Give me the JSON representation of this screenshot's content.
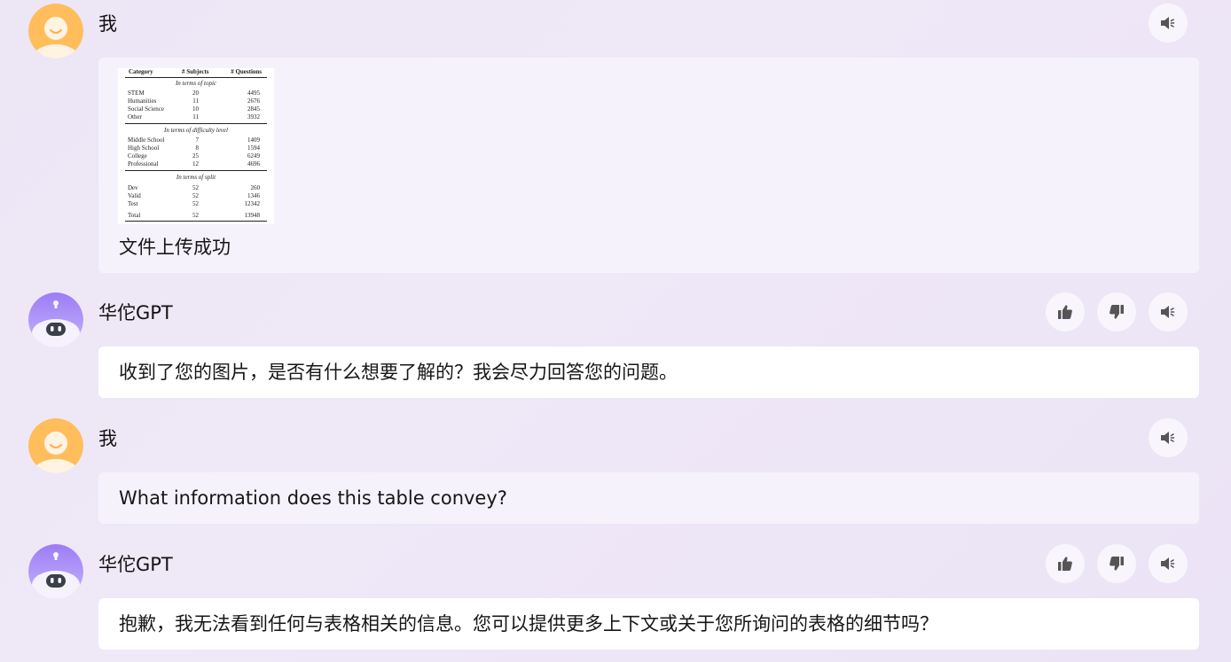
{
  "messages": [
    {
      "role": "user",
      "name": "我",
      "image_table": {
        "headers": [
          "Category",
          "# Subjects",
          "# Questions"
        ],
        "sections": [
          {
            "title": "In terms of topic",
            "rows": [
              [
                "STEM",
                "20",
                "4495"
              ],
              [
                "Humanities",
                "11",
                "2676"
              ],
              [
                "Social Science",
                "10",
                "2845"
              ],
              [
                "Other",
                "11",
                "3932"
              ]
            ]
          },
          {
            "title": "In terms of difficulty level",
            "rows": [
              [
                "Middle School",
                "7",
                "1409"
              ],
              [
                "High School",
                "8",
                "1594"
              ],
              [
                "College",
                "25",
                "6249"
              ],
              [
                "Professional",
                "12",
                "4696"
              ]
            ]
          },
          {
            "title": "In terms of split",
            "rows": [
              [
                "Dev",
                "52",
                "260"
              ],
              [
                "Valid",
                "52",
                "1346"
              ],
              [
                "Test",
                "52",
                "12342"
              ]
            ]
          }
        ],
        "total": [
          "Total",
          "52",
          "13948"
        ]
      },
      "text": "文件上传成功"
    },
    {
      "role": "assistant",
      "name": "华佗GPT",
      "text": "收到了您的图片，是否有什么想要了解的？我会尽力回答您的问题。"
    },
    {
      "role": "user",
      "name": "我",
      "text": "What information does this table convey?"
    },
    {
      "role": "assistant",
      "name": "华佗GPT",
      "text": "抱歉，我无法看到任何与表格相关的信息。您可以提供更多上下文或关于您所询问的表格的细节吗？"
    }
  ],
  "icons": {
    "speaker": "speaker-icon",
    "like": "thumbs-up-icon",
    "dislike": "thumbs-down-icon"
  },
  "colors": {
    "user_avatar": "#ffb74d",
    "bot_avatar": "#a78bfa",
    "user_bubble": "#f6f2fc",
    "bot_bubble": "#ffffff",
    "icon": "#555555"
  }
}
